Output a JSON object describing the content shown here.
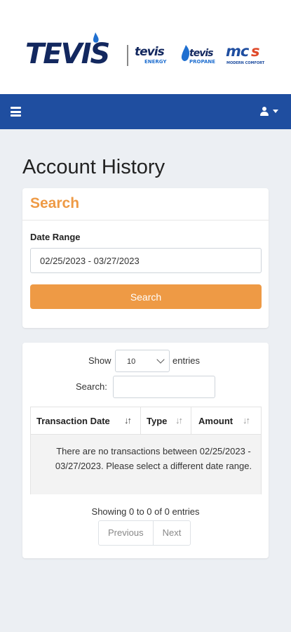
{
  "brand": {
    "main_logo_text": "TEVIS",
    "sub_logos": [
      "TEVIS ENERGY",
      "TEVIS PROPANE",
      "MCS MODERN COMFORT"
    ],
    "colors": {
      "navy": "#13285f",
      "blue": "#1f4ea0",
      "orange": "#ee9a45"
    }
  },
  "navbar": {
    "menu_icon": "hamburger-menu-icon",
    "user_icon": "user-icon"
  },
  "page": {
    "title": "Account History"
  },
  "search_card": {
    "title": "Search",
    "date_range_label": "Date Range",
    "date_range_value": "02/25/2023 - 03/27/2023",
    "button_label": "Search"
  },
  "table_controls": {
    "show_label": "Show",
    "page_length_value": "10",
    "entries_label": "entries",
    "search_label": "Search:",
    "search_value": ""
  },
  "table": {
    "columns": [
      "Transaction Date",
      "Type",
      "Amount"
    ],
    "empty_message": "There are no transactions between 02/25/2023 - 03/27/2023. Please select a different date range.",
    "info": "Showing 0 to 0 of 0 entries"
  },
  "pagination": {
    "previous_label": "Previous",
    "next_label": "Next"
  }
}
